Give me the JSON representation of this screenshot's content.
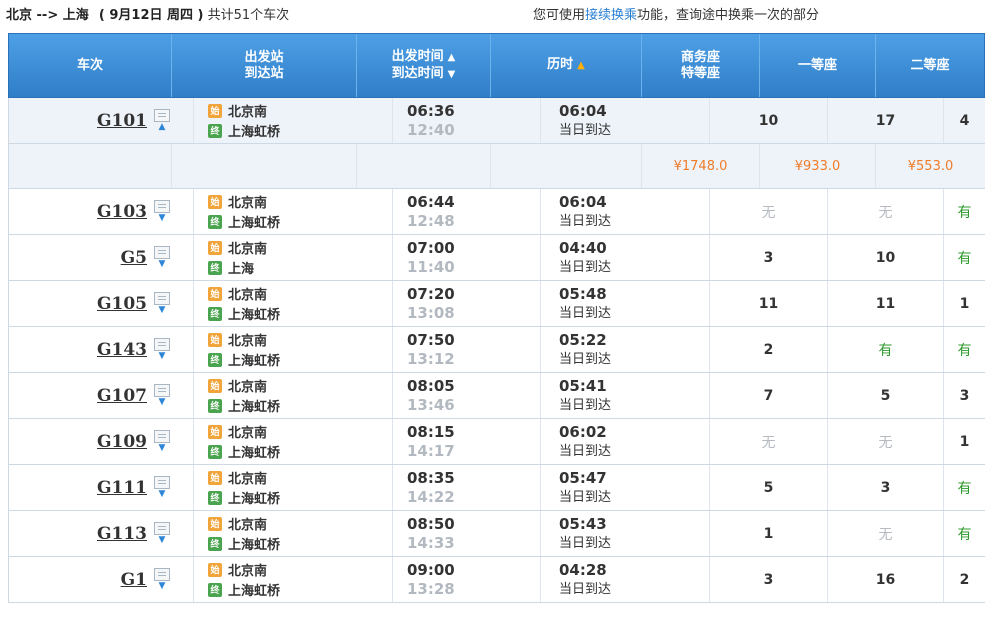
{
  "summary": {
    "route": "北京 --> 上海",
    "date": "( 9月12日  周四 )",
    "count_text": "共计51个车次",
    "hint_prefix": "您可使用",
    "hint_link": "接续换乘",
    "hint_suffix": "功能，查询途中换乘一次的部分"
  },
  "header": {
    "train": "车次",
    "station_top": "出发站",
    "station_bottom": "到达站",
    "time_top": "出发时间",
    "time_bottom": "到达时间",
    "duration": "历时",
    "biz_top": "商务座",
    "biz_bottom": "特等座",
    "first": "一等座",
    "second": "二等座"
  },
  "arrival_label": "当日到达",
  "badges": {
    "start": "始",
    "end": "终"
  },
  "rows": [
    {
      "train": "G101",
      "expanded": true,
      "from": "北京南",
      "to": "上海虹桥",
      "dep": "06:36",
      "arr": "12:40",
      "duration": "06:04",
      "biz": "10",
      "first": "17",
      "second": "4"
    },
    {
      "train": "G103",
      "from": "北京南",
      "to": "上海虹桥",
      "dep": "06:44",
      "arr": "12:48",
      "duration": "06:04",
      "biz": "无",
      "first": "无",
      "second": "有"
    },
    {
      "train": "G5",
      "from": "北京南",
      "to": "上海",
      "dep": "07:00",
      "arr": "11:40",
      "duration": "04:40",
      "biz": "3",
      "first": "10",
      "second": "有"
    },
    {
      "train": "G105",
      "from": "北京南",
      "to": "上海虹桥",
      "dep": "07:20",
      "arr": "13:08",
      "duration": "05:48",
      "biz": "11",
      "first": "11",
      "second": "1"
    },
    {
      "train": "G143",
      "from": "北京南",
      "to": "上海虹桥",
      "dep": "07:50",
      "arr": "13:12",
      "duration": "05:22",
      "biz": "2",
      "first": "有",
      "second": "有"
    },
    {
      "train": "G107",
      "from": "北京南",
      "to": "上海虹桥",
      "dep": "08:05",
      "arr": "13:46",
      "duration": "05:41",
      "biz": "7",
      "first": "5",
      "second": "3"
    },
    {
      "train": "G109",
      "from": "北京南",
      "to": "上海虹桥",
      "dep": "08:15",
      "arr": "14:17",
      "duration": "06:02",
      "biz": "无",
      "first": "无",
      "second": "1"
    },
    {
      "train": "G111",
      "from": "北京南",
      "to": "上海虹桥",
      "dep": "08:35",
      "arr": "14:22",
      "duration": "05:47",
      "biz": "5",
      "first": "3",
      "second": "有"
    },
    {
      "train": "G113",
      "from": "北京南",
      "to": "上海虹桥",
      "dep": "08:50",
      "arr": "14:33",
      "duration": "05:43",
      "biz": "1",
      "first": "无",
      "second": "有"
    },
    {
      "train": "G1",
      "from": "北京南",
      "to": "上海虹桥",
      "dep": "09:00",
      "arr": "13:28",
      "duration": "04:28",
      "biz": "3",
      "first": "16",
      "second": "2"
    }
  ],
  "price_row": {
    "biz": "¥1748.0",
    "first": "¥933.0",
    "second": "¥553.0"
  },
  "colors": {
    "header_blue": "#2f7ec8",
    "price_orange": "#f07c2a",
    "available_green": "#2e9a2e",
    "unavailable_gray": "#b6bbc1",
    "link_blue": "#2a7fd4"
  }
}
